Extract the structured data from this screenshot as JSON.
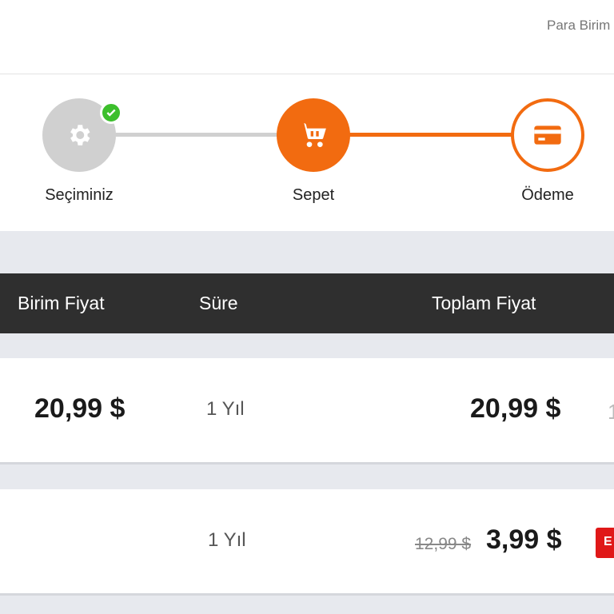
{
  "header": {
    "currency_label": "Para Birim"
  },
  "steps": [
    {
      "label": "Seçiminiz",
      "icon": "gear-icon",
      "status": "completed"
    },
    {
      "label": "Sepet",
      "icon": "cart-icon",
      "status": "active"
    },
    {
      "label": "Ödeme",
      "icon": "credit-card-icon",
      "status": "upcoming"
    }
  ],
  "table": {
    "headers": [
      "Birim Fiyat",
      "Süre",
      "Toplam Fiyat"
    ],
    "rows": [
      {
        "unit_price": "20,99 $",
        "duration": "1  Yıl",
        "total": "20,99 $",
        "cut_text": "1"
      },
      {
        "unit_price": "",
        "duration": "1 Yıl",
        "old_price": "12,99 $",
        "total": "3,99 $",
        "badge": "E"
      }
    ]
  },
  "colors": {
    "accent": "#f26b10",
    "completed": "#3cbf2c",
    "inactive": "#d0d0d0",
    "header_bg": "#2f2f2f",
    "badge": "#e01818"
  }
}
